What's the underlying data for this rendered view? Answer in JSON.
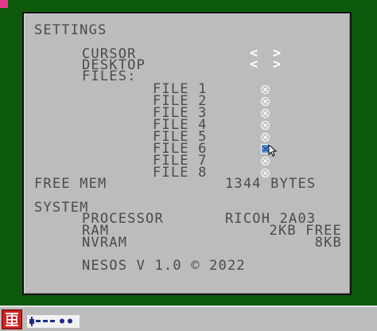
{
  "settings": {
    "title": "SETTINGS",
    "cursor_label": "CURSOR",
    "desktop_label": "DESKTOP",
    "files_label": "FILES:",
    "left_arrow": "<",
    "right_arrow": ">",
    "files": [
      {
        "label": "FILE 1",
        "state": "empty"
      },
      {
        "label": "FILE 2",
        "state": "empty"
      },
      {
        "label": "FILE 3",
        "state": "empty"
      },
      {
        "label": "FILE 4",
        "state": "empty"
      },
      {
        "label": "FILE 5",
        "state": "empty"
      },
      {
        "label": "FILE 6",
        "state": "selected"
      },
      {
        "label": "FILE 7",
        "state": "empty"
      },
      {
        "label": "FILE 8",
        "state": "empty"
      }
    ],
    "free_mem_label": "FREE MEM",
    "free_mem_value": "1344 BYTES"
  },
  "system": {
    "title": "SYSTEM",
    "processor_label": "PROCESSOR",
    "processor_value": "RICOH 2A03",
    "ram_label": "RAM",
    "ram_value": "2KB FREE",
    "nvram_label": "NVRAM",
    "nvram_value": "8KB",
    "version": "NESOS V 1.0 © 2022"
  },
  "colors": {
    "desktop": "#0d5a0d",
    "window": "#bcbcbc",
    "text": "#4b4b4b",
    "accent_selected": "#5b8fd8",
    "start_button": "#cc2222"
  },
  "taskbar": {
    "start_icon": "nesos-logo-icon",
    "task_icon": "app-window-icon"
  }
}
